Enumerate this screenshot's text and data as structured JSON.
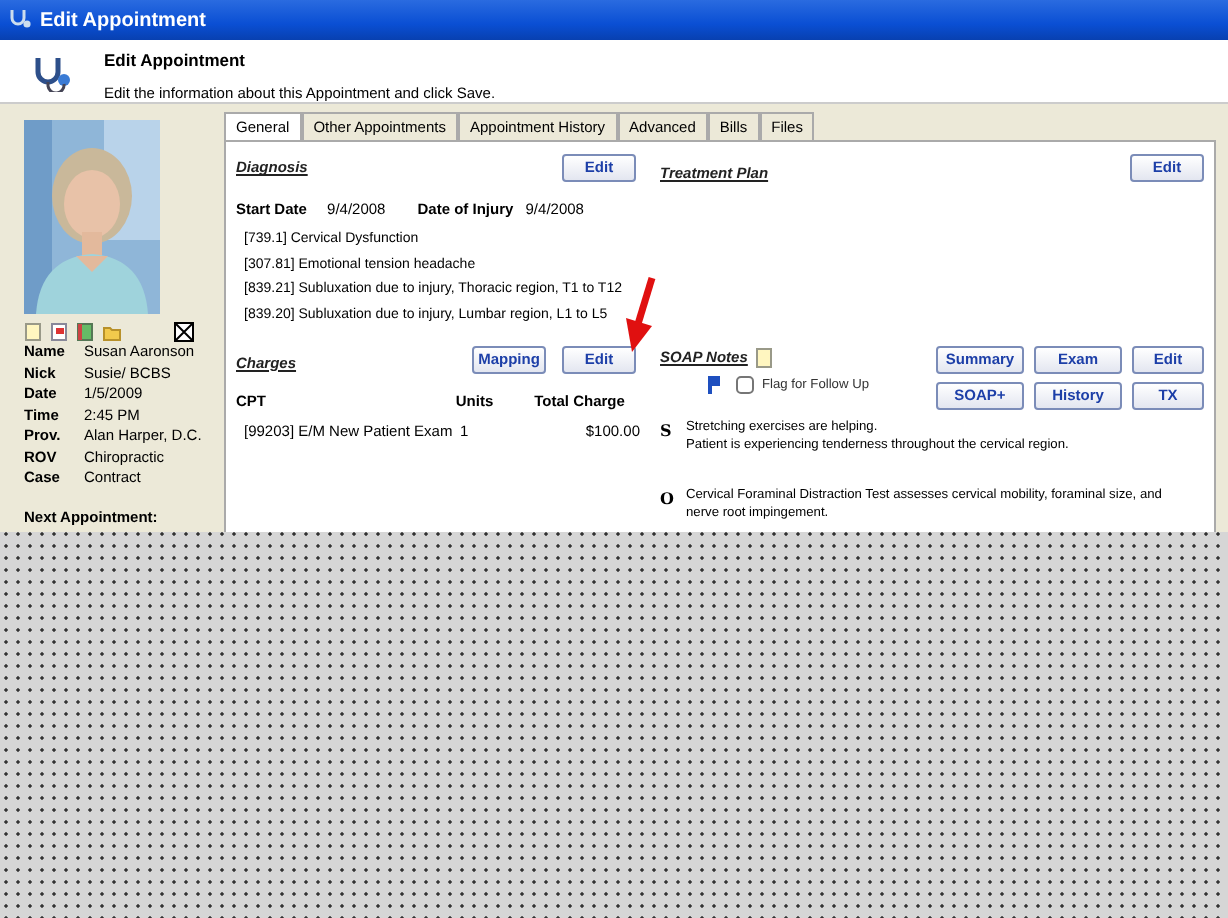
{
  "window": {
    "title": "Edit Appointment"
  },
  "header": {
    "title": "Edit Appointment",
    "subtitle": "Edit the information about this Appointment and click Save."
  },
  "patient": {
    "fields": [
      {
        "label": "Name",
        "value": "Susan Aaronson"
      },
      {
        "label": "Nick",
        "value": "Susie/ BCBS"
      },
      {
        "label": "Date",
        "value": "1/5/2009"
      },
      {
        "label": "Time",
        "value": "2:45 PM"
      },
      {
        "label": "Prov.",
        "value": "Alan Harper, D.C."
      },
      {
        "label": "ROV",
        "value": "Chiropractic"
      },
      {
        "label": "Case",
        "value": "Contract"
      }
    ],
    "next_appointment_label": "Next Appointment:"
  },
  "tabs": [
    {
      "label": "General",
      "selected": true
    },
    {
      "label": "Other Appointments",
      "selected": false
    },
    {
      "label": "Appointment History",
      "selected": false
    },
    {
      "label": "Advanced",
      "selected": false
    },
    {
      "label": "Bills",
      "selected": false
    },
    {
      "label": "Files",
      "selected": false
    }
  ],
  "diagnosis": {
    "title": "Diagnosis",
    "edit_button": "Edit",
    "start_date_label": "Start Date",
    "start_date": "9/4/2008",
    "injury_label": "Date of Injury",
    "injury_date": "9/4/2008",
    "codes": [
      "[739.1] Cervical Dysfunction",
      "[307.81] Emotional tension headache",
      "[839.21] Subluxation due to injury, Thoracic region, T1 to T12",
      "[839.20] Subluxation due to injury, Lumbar region, L1 to L5"
    ]
  },
  "charges": {
    "title": "Charges",
    "buttons": [
      "Mapping",
      "Edit"
    ],
    "columns": [
      "CPT",
      "Units",
      "Total Charge"
    ],
    "rows": [
      [
        "[99203] E/M New Patient Exam",
        "1",
        "$100.00"
      ]
    ]
  },
  "treatment_plan": {
    "title": "Treatment Plan",
    "edit_button": "Edit"
  },
  "soap_notes": {
    "title": "SOAP Notes",
    "buttons": [
      "Summary",
      "Exam",
      "Edit",
      "SOAP+",
      "History",
      "TX"
    ],
    "flag": {
      "label": "Flag for Follow Up",
      "checked": false
    },
    "notes": [
      {
        "letter": "S",
        "lines": [
          "Stretching exercises are helping.",
          "Patient is experiencing tenderness throughout the cervical region."
        ]
      },
      {
        "letter": "O",
        "lines": [
          "Cervical Foraminal Distraction Test assesses cervical mobility, foraminal size, and",
          "nerve root impingement."
        ]
      }
    ]
  }
}
